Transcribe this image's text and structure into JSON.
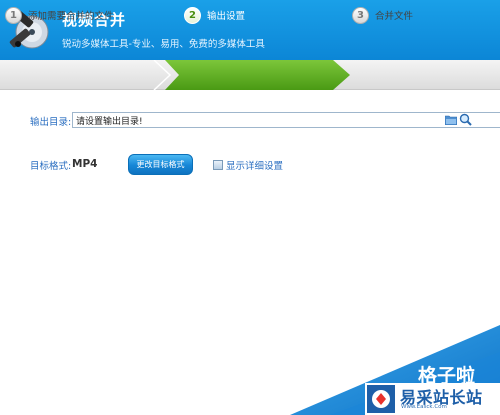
{
  "header": {
    "title": "视频合并",
    "subtitle": "锐动多媒体工具-专业、易用、免费的多媒体工具"
  },
  "steps": [
    {
      "num": "1",
      "label": "添加需要合并的文件",
      "active": false
    },
    {
      "num": "2",
      "label": "输出设置",
      "active": true
    },
    {
      "num": "3",
      "label": "合并文件",
      "active": false
    }
  ],
  "output": {
    "dir_label": "输出目录:",
    "dir_value": "请设置输出目录!",
    "format_label": "目标格式:",
    "format_value": "MP4",
    "change_button": "更改目标格式",
    "detail_label": "显示详细设置"
  },
  "watermark": {
    "text": "格子啦",
    "brand_name": "易采站长站",
    "brand_url": "Www.Easck.Com"
  },
  "colors": {
    "header_blue": "#0c86d6",
    "step_green": "#5aa81e",
    "label_blue": "#2a6ec0",
    "corner_blue": "#1c8be0"
  }
}
